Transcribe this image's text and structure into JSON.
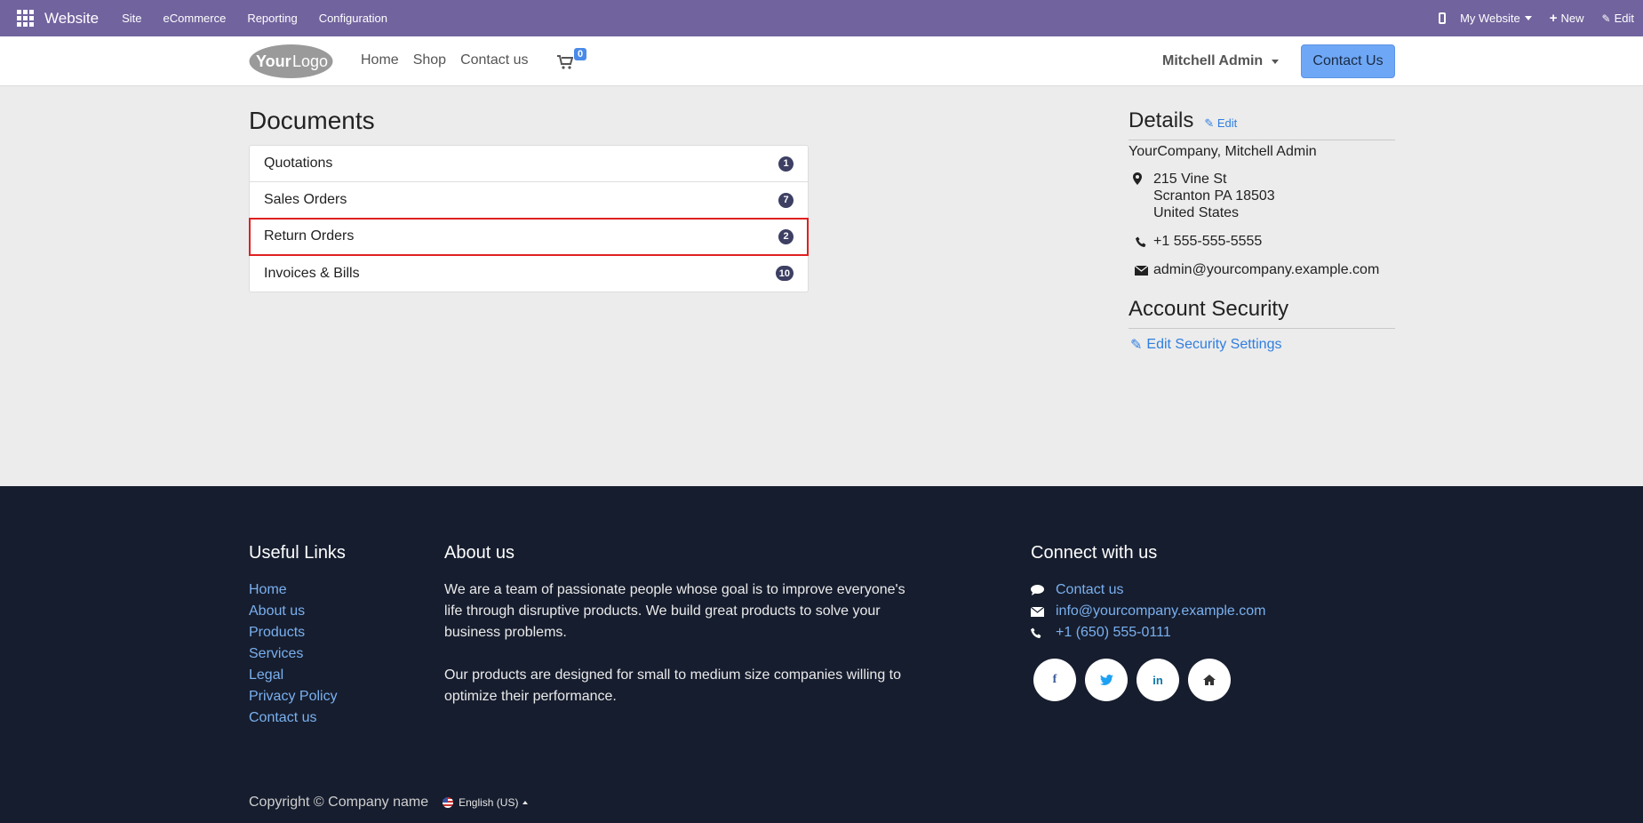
{
  "adminbar": {
    "brand": "Website",
    "menus": [
      "Site",
      "eCommerce",
      "Reporting",
      "Configuration"
    ],
    "website_selector": "My Website",
    "new_label": "New",
    "edit_label": "Edit"
  },
  "header": {
    "nav": [
      "Home",
      "Shop",
      "Contact us"
    ],
    "cart_count": "0",
    "user_name": "Mitchell Admin",
    "contact_button": "Contact Us"
  },
  "documents": {
    "title": "Documents",
    "items": [
      {
        "label": "Quotations",
        "count": "1"
      },
      {
        "label": "Sales Orders",
        "count": "7"
      },
      {
        "label": "Return Orders",
        "count": "2"
      },
      {
        "label": "Invoices & Bills",
        "count": "10"
      }
    ]
  },
  "details": {
    "title": "Details",
    "edit_label": "Edit",
    "name": "YourCompany, Mitchell Admin",
    "address": [
      "215 Vine St",
      "Scranton PA 18503",
      "United States"
    ],
    "phone": "+1 555-555-5555",
    "email": "admin@yourcompany.example.com"
  },
  "security": {
    "title": "Account Security",
    "edit_link": "Edit Security Settings"
  },
  "footer": {
    "useful_links_title": "Useful Links",
    "links": [
      "Home",
      "About us",
      "Products",
      "Services",
      "Legal",
      "Privacy Policy",
      "Contact us"
    ],
    "about_title": "About us",
    "about_p1": "We are a team of passionate people whose goal is to improve everyone's life through disruptive products. We build great products to solve your business problems.",
    "about_p2": "Our products are designed for small to medium size companies willing to optimize their performance.",
    "connect_title": "Connect with us",
    "connect_contact": "Contact us",
    "connect_email": "info@yourcompany.example.com",
    "connect_phone": "+1 (650) 555-0111",
    "copyright": "Copyright © Company name",
    "language": "English (US)"
  },
  "colors": {
    "admin_bar": "#71639e",
    "primary_button": "#6ea7f5",
    "link": "#2f7ee0",
    "footer_bg": "#161d2e",
    "highlight": "#e02020"
  }
}
